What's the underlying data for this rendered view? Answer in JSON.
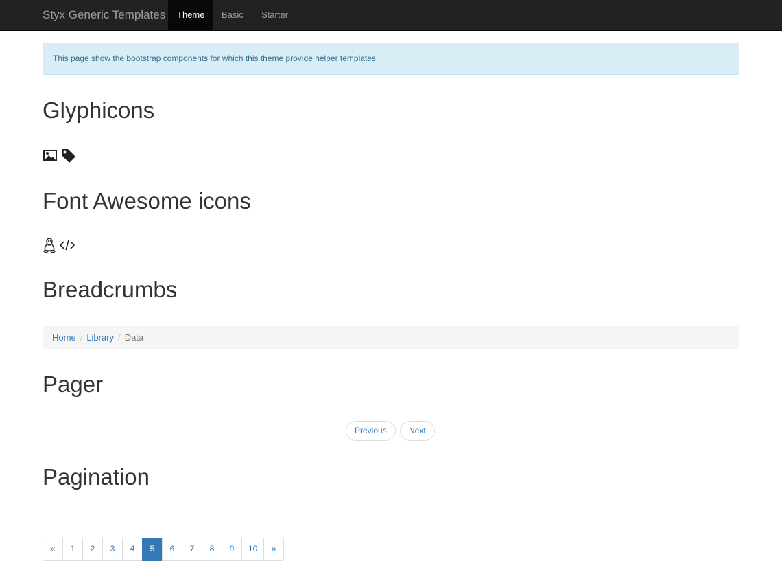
{
  "navbar": {
    "brand": "Styx Generic Templates",
    "items": [
      {
        "label": "Theme",
        "active": true
      },
      {
        "label": "Basic",
        "active": false
      },
      {
        "label": "Starter",
        "active": false
      }
    ]
  },
  "alert": {
    "text": "This page show the bootstrap components for which this theme provide helper templates."
  },
  "sections": {
    "glyphicons": {
      "title": "Glyphicons",
      "icons": [
        "picture-icon",
        "tag-icon"
      ]
    },
    "font_awesome": {
      "title": "Font Awesome icons",
      "icons": [
        "linux-icon",
        "code-icon"
      ]
    },
    "breadcrumbs": {
      "title": "Breadcrumbs",
      "items": [
        {
          "label": "Home",
          "link": true
        },
        {
          "label": "Library",
          "link": true
        },
        {
          "label": "Data",
          "link": false
        }
      ],
      "separator": "/"
    },
    "pager": {
      "title": "Pager",
      "previous": "Previous",
      "next": "Next"
    },
    "pagination": {
      "title": "Pagination",
      "prev": "«",
      "next": "»",
      "pages": [
        "1",
        "2",
        "3",
        "4",
        "5",
        "6",
        "7",
        "8",
        "9",
        "10"
      ],
      "active_page": "5"
    }
  },
  "colors": {
    "navbar_bg": "#222222",
    "link": "#337ab7",
    "alert_bg": "#d9edf7",
    "alert_text": "#31708f"
  }
}
